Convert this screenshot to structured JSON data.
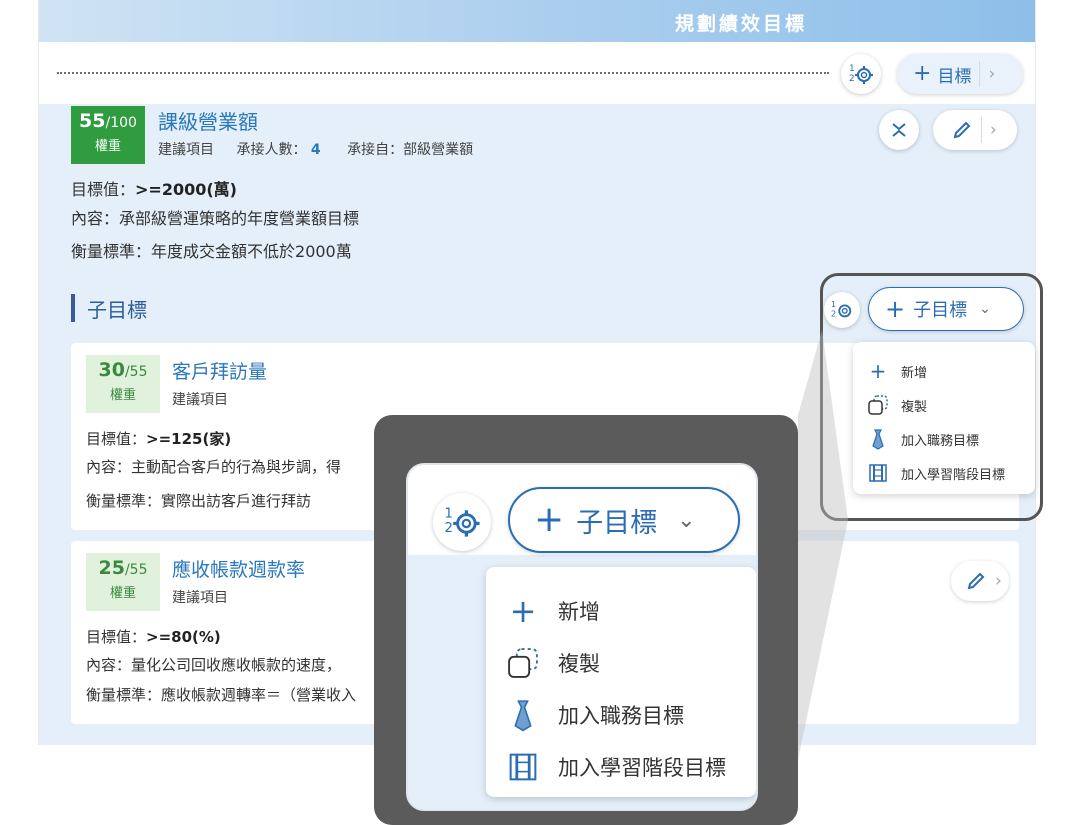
{
  "app": {
    "title": "規劃績效目標"
  },
  "toolbar": {
    "add_goal_label": "目標"
  },
  "goal": {
    "score": "55",
    "score_total": "/100",
    "weight_label": "權重",
    "title": "課級營業額",
    "type": "建議項目",
    "assignees_label": "承接人數：",
    "assignees": "4",
    "source_label": "承接自：",
    "source": "部級營業額",
    "target_label": "目標值：",
    "target": ">=2000(萬)",
    "content_label": "內容：",
    "content": "承部級營運策略的年度營業額目標",
    "measure_label": "衡量標準：",
    "measure": "年度成交金額不低於2000萬"
  },
  "subgoals": {
    "title": "子目標",
    "add_label": "子目標",
    "items": [
      {
        "score": "30",
        "score_total": "/55",
        "weight_label": "權重",
        "title": "客戶拜訪量",
        "type": "建議項目",
        "target_label": "目標值：",
        "target": ">=125(家)",
        "content_label": "內容：",
        "content": "主動配合客戶的行為與步調，得",
        "measure_label": "衡量標準：",
        "measure": "實際出訪客戶進行拜訪"
      },
      {
        "score": "25",
        "score_total": "/55",
        "weight_label": "權重",
        "title": "應收帳款週款率",
        "type": "建議項目",
        "target_label": "目標值：",
        "target": ">=80(%)",
        "content_label": "內容：",
        "content": "量化公司回收應收帳款的速度，",
        "measure_label": "衡量標準：",
        "measure": "應收帳款週轉率＝（營業收入"
      }
    ]
  },
  "menu": {
    "items": [
      {
        "label": "新增",
        "icon": "plus-icon"
      },
      {
        "label": "複製",
        "icon": "copy-icon"
      },
      {
        "label": "加入職務目標",
        "icon": "tie-icon"
      },
      {
        "label": "加入學習階段目標",
        "icon": "ladder-icon"
      }
    ]
  },
  "colors": {
    "accent": "#2a78bd",
    "score_green": "#2e9c3f",
    "frame_bg": "#e4eff9"
  }
}
